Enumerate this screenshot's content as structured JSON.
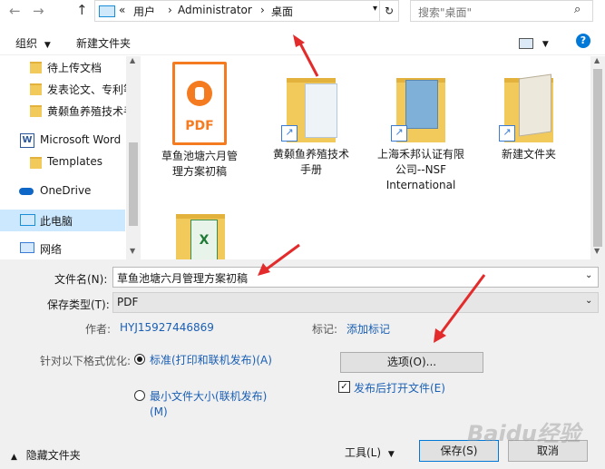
{
  "address": {
    "back_glyph": "←",
    "forward_glyph": "→",
    "up_glyph": "↑",
    "overflow": "«",
    "crumbs": [
      "用户",
      "Administrator",
      "桌面"
    ],
    "search_placeholder": "搜索\"桌面\""
  },
  "toolbar": {
    "organize": "组织",
    "new_folder": "新建文件夹"
  },
  "sidebar": {
    "items": [
      {
        "label": "待上传文档",
        "icon": "folder-icon"
      },
      {
        "label": "发表论文、专利等",
        "icon": "folder-icon"
      },
      {
        "label": "黄颡鱼养殖技术手册",
        "icon": "folder-icon"
      },
      {
        "label": "Microsoft Word",
        "icon": "word-icon"
      },
      {
        "label": "Templates",
        "icon": "folder-icon"
      },
      {
        "label": "OneDrive",
        "icon": "cloud-icon"
      },
      {
        "label": "此电脑",
        "icon": "computer-icon"
      },
      {
        "label": "网络",
        "icon": "network-icon"
      }
    ]
  },
  "files": [
    {
      "name": "草鱼池塘六月管理方案初稿",
      "icon": "pdf-icon",
      "badge": "PDF"
    },
    {
      "name": "黄颡鱼养殖技术手册",
      "icon": "folder-shortcut-icon"
    },
    {
      "name": "上海禾邦认证有限公司--NSF International",
      "icon": "folder-shortcut-icon"
    },
    {
      "name": "新建文件夹",
      "icon": "folder-shortcut-icon"
    },
    {
      "name": "",
      "icon": "excel-folder-icon"
    }
  ],
  "form": {
    "filename_label": "文件名(N):",
    "filename_value": "草鱼池塘六月管理方案初稿",
    "type_label": "保存类型(T):",
    "type_value": "PDF",
    "author_label": "作者:",
    "author_value": "HYJ15927446869",
    "tags_label": "标记:",
    "tags_value": "添加标记",
    "optimize_label": "针对以下格式优化:",
    "option_standard": "标准(打印和联机发布)(A)",
    "option_minimum": "最小文件大小(联机发布)(M)",
    "options_button": "选项(O)...",
    "open_after": "发布后打开文件(E)"
  },
  "footer": {
    "hide_folders": "隐藏文件夹",
    "tools": "工具(L)",
    "save": "保存(S)",
    "cancel": "取消"
  },
  "watermark": "Baidu经验",
  "colors": {
    "accent": "#0078d7",
    "link": "#1a5fb4",
    "annotation_arrow": "#e32b2b",
    "pdf_orange": "#f47b20",
    "folder_yellow": "#f2ca5c"
  }
}
